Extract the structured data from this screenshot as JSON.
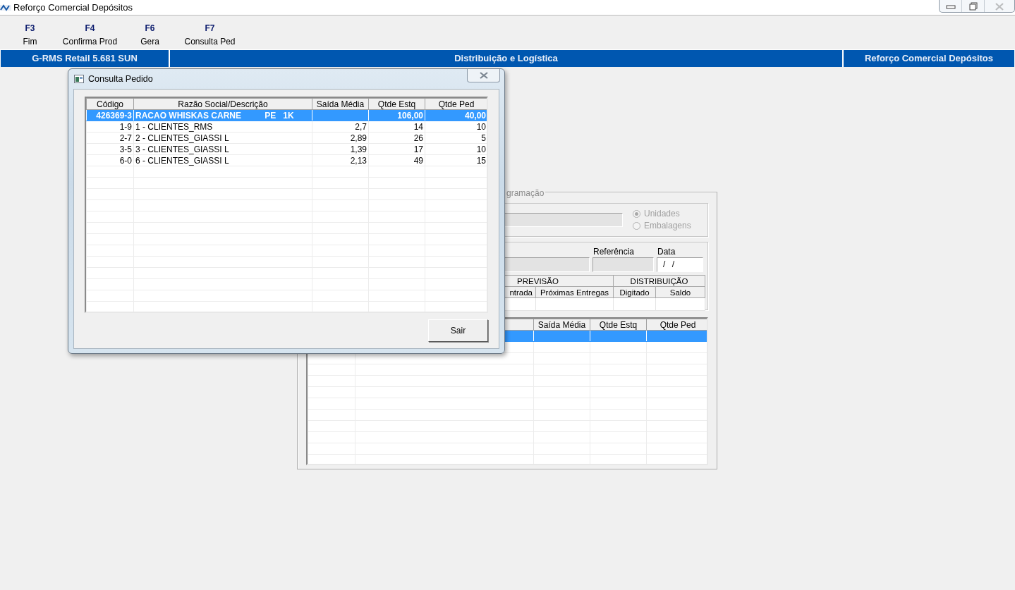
{
  "window": {
    "title": "Reforço Comercial Depósitos",
    "controls": [
      {
        "kind": "minimize",
        "disabled": false
      },
      {
        "kind": "restore",
        "disabled": false
      },
      {
        "kind": "close",
        "disabled": true
      }
    ]
  },
  "toolbar": [
    {
      "key": "F3",
      "label": "Fim"
    },
    {
      "key": "F4",
      "label": "Confirma Prod"
    },
    {
      "key": "F6",
      "label": "Gera"
    },
    {
      "key": "F7",
      "label": "Consulta Ped"
    }
  ],
  "header_bar": [
    "G-RMS Retail 5.681 SUN",
    "Distribuição e Logística",
    "Reforço Comercial Depósitos"
  ],
  "background_form": {
    "group_title": "gramação",
    "units": [
      {
        "label": "Unidades",
        "selected": true,
        "disabled": true
      },
      {
        "label": "Embalagens",
        "selected": false,
        "disabled": true
      }
    ],
    "reference_label": "Referência",
    "date_label": "Data",
    "date_value": "/ /",
    "forecast_groups": [
      "PREVISÃO",
      "DISTRIBUIÇÃO"
    ],
    "forecast_columns": [
      "ntrada",
      "Próximas Entregas",
      "Digitado",
      "Saldo"
    ],
    "grid": {
      "columns": [
        "Saída Média",
        "Qtde Estq",
        "Qtde Ped"
      ],
      "rows": [
        {
          "selected": true
        },
        {
          "selected": false
        },
        {
          "selected": false
        },
        {
          "selected": false
        },
        {
          "selected": false
        },
        {
          "selected": false
        },
        {
          "selected": false
        },
        {
          "selected": false
        },
        {
          "selected": false
        },
        {
          "selected": false
        },
        {
          "selected": false
        },
        {
          "selected": false
        }
      ]
    }
  },
  "dialog": {
    "title": "Consulta Pedido",
    "columns": [
      "Código",
      "Razão Social/Descrição",
      "Saída Média",
      "Qtde Estq",
      "Qtde Ped"
    ],
    "rows": [
      {
        "kind": "product",
        "selected": true,
        "cells": [
          "426369-3",
          "RACAO WHISKAS CARNE          PE   1K",
          "",
          "106,00",
          "40,00"
        ]
      },
      {
        "kind": "client",
        "selected": false,
        "cells": [
          "1-9",
          "1 - CLIENTES_RMS",
          "2,7",
          "14",
          "10"
        ]
      },
      {
        "kind": "client",
        "selected": false,
        "cells": [
          "2-7",
          "2 - CLIENTES_GIASSI L",
          "2,89",
          "26",
          "5"
        ]
      },
      {
        "kind": "client",
        "selected": false,
        "cells": [
          "3-5",
          "3 - CLIENTES_GIASSI L",
          "1,39",
          "17",
          "10"
        ]
      },
      {
        "kind": "client",
        "selected": false,
        "cells": [
          "6-0",
          "6 - CLIENTES_GIASSI L",
          "2,13",
          "49",
          "15"
        ]
      }
    ],
    "button": "Sair"
  }
}
